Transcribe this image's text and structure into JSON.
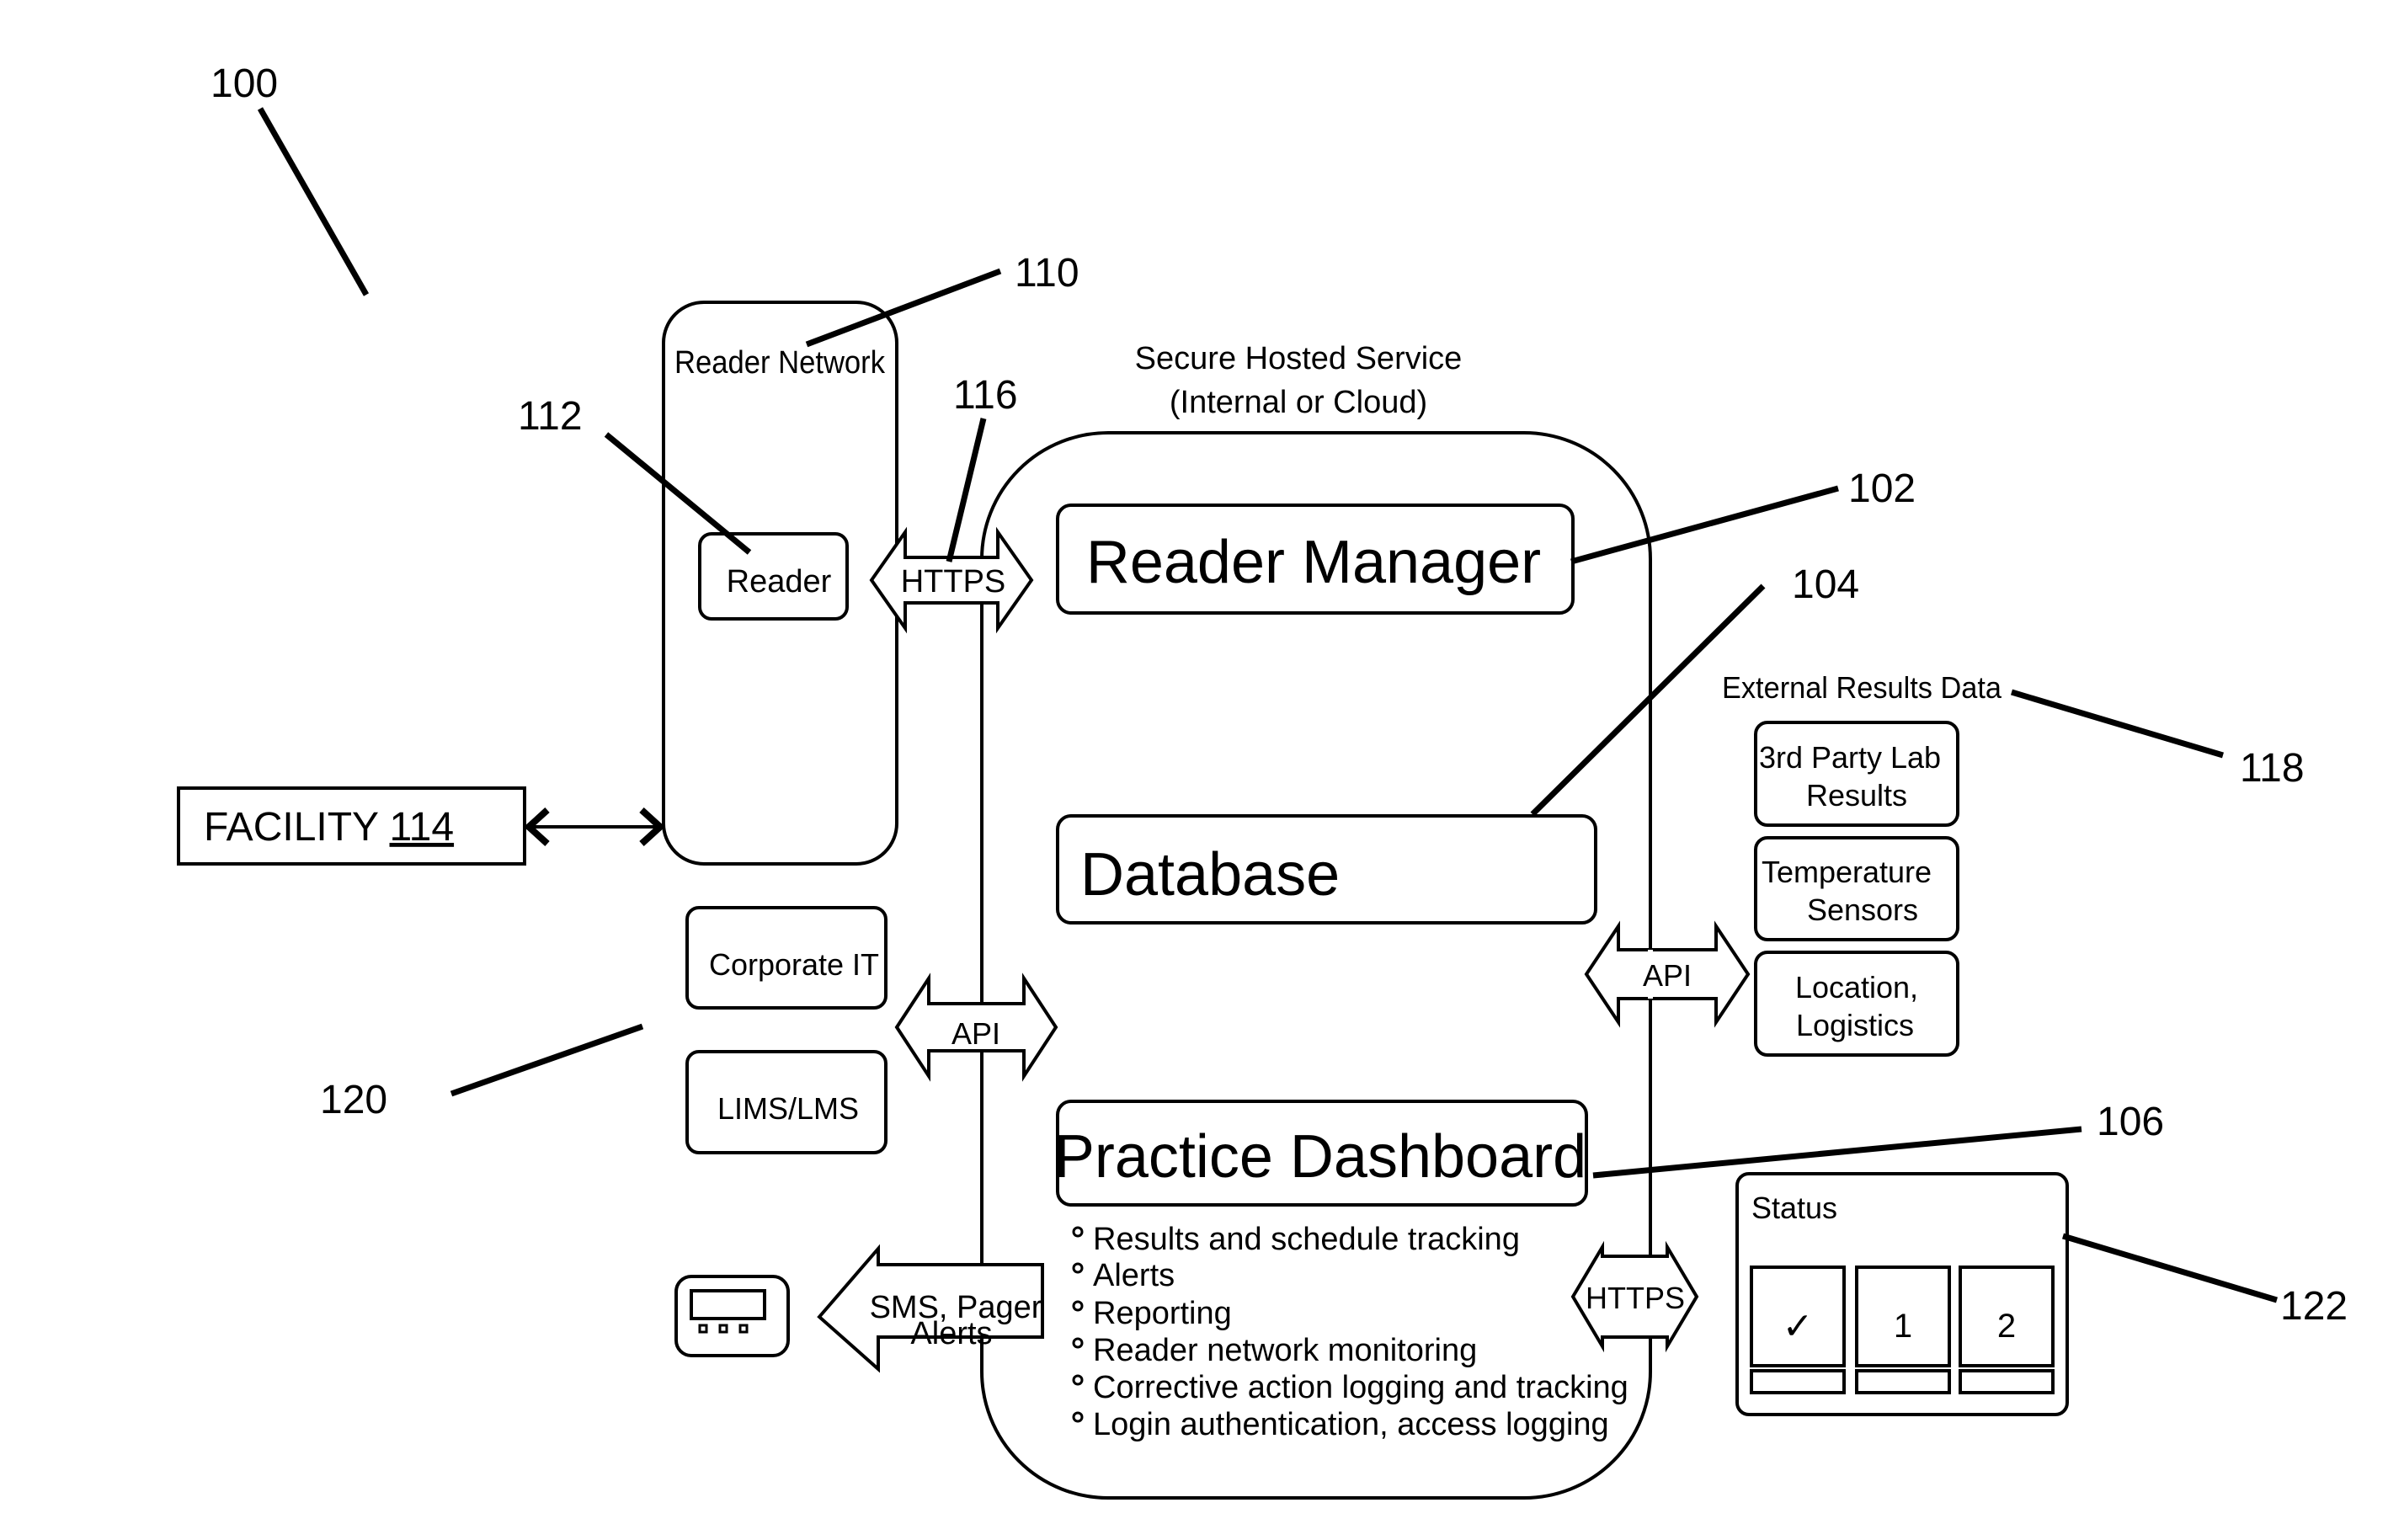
{
  "figure": {
    "ref_main": "100",
    "secure_service": {
      "title_line1": "Secure Hosted Service",
      "title_line2": "(Internal or Cloud)"
    },
    "reader_network": {
      "label": "Reader Network",
      "ref": "110"
    },
    "reader": {
      "label": "Reader",
      "ref": "112"
    },
    "facility": {
      "label": "FACILITY ",
      "ref": "114"
    },
    "https_left": {
      "label": "HTTPS",
      "ref": "116"
    },
    "reader_manager": {
      "label": "Reader Manager",
      "ref": "102"
    },
    "database": {
      "label": "Database",
      "ref": "104"
    },
    "practice_dashboard": {
      "label": "Practice Dashboard",
      "ref": "106",
      "features": [
        "Results and schedule tracking",
        "Alerts",
        "Reporting",
        "Reader network monitoring",
        "Corrective action logging and tracking",
        "Login authentication, access logging"
      ]
    },
    "external_results": {
      "title": "External Results Data",
      "ref": "118",
      "items": [
        {
          "line1": "3rd Party Lab",
          "line2": "Results"
        },
        {
          "line1": "Temperature",
          "line2": "Sensors"
        },
        {
          "line1": "Location,",
          "line2": "Logistics"
        }
      ]
    },
    "api_right": {
      "label": "API"
    },
    "api_left": {
      "label": "API"
    },
    "enterprise_systems": {
      "ref": "120",
      "items": [
        "Corporate IT",
        "LIMS/LMS"
      ]
    },
    "sms_alerts": {
      "line1": "SMS, Pager",
      "line2": "Alerts"
    },
    "pager_device": {
      "icon": "pager-icon"
    },
    "https_right": {
      "label": "HTTPS"
    },
    "status_panel": {
      "title": "Status",
      "ref": "122",
      "cells": [
        "✓",
        "1",
        "2"
      ]
    }
  }
}
